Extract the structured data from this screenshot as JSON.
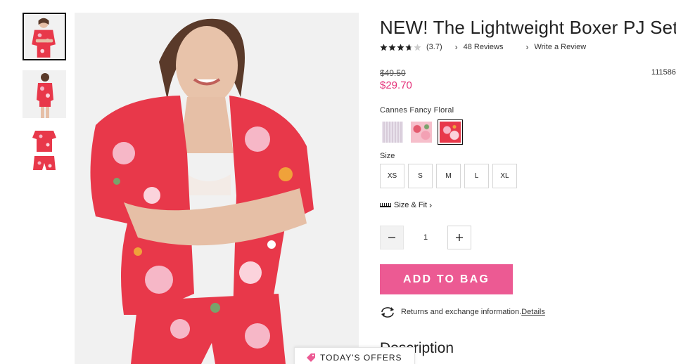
{
  "product": {
    "title": "NEW! The Lightweight Boxer PJ Set",
    "rating_value": 3.7,
    "rating_text": "(3.7)",
    "reviews_link": "48 Reviews",
    "write_review_link": "Write a Review",
    "old_price": "$49.50",
    "sale_price": "$29.70",
    "sku": "111586",
    "color_name": "Cannes Fancy Floral"
  },
  "colors": {
    "accent_pink": "#ec5a93",
    "sale_price": "#e4327a",
    "pattern_red": "#e8384a"
  },
  "sizes": {
    "label": "Size",
    "options": [
      "XS",
      "S",
      "M",
      "L",
      "XL"
    ],
    "fit_link": "Size & Fit"
  },
  "quantity": {
    "value": "1",
    "minus_icon": "minus-icon",
    "plus_icon": "plus-icon"
  },
  "actions": {
    "add_to_bag": "ADD TO BAG",
    "returns_text": "Returns and exchange information.",
    "details_link": "Details"
  },
  "sections": {
    "description_heading": "Description",
    "offers_button": "TODAY'S OFFERS"
  }
}
